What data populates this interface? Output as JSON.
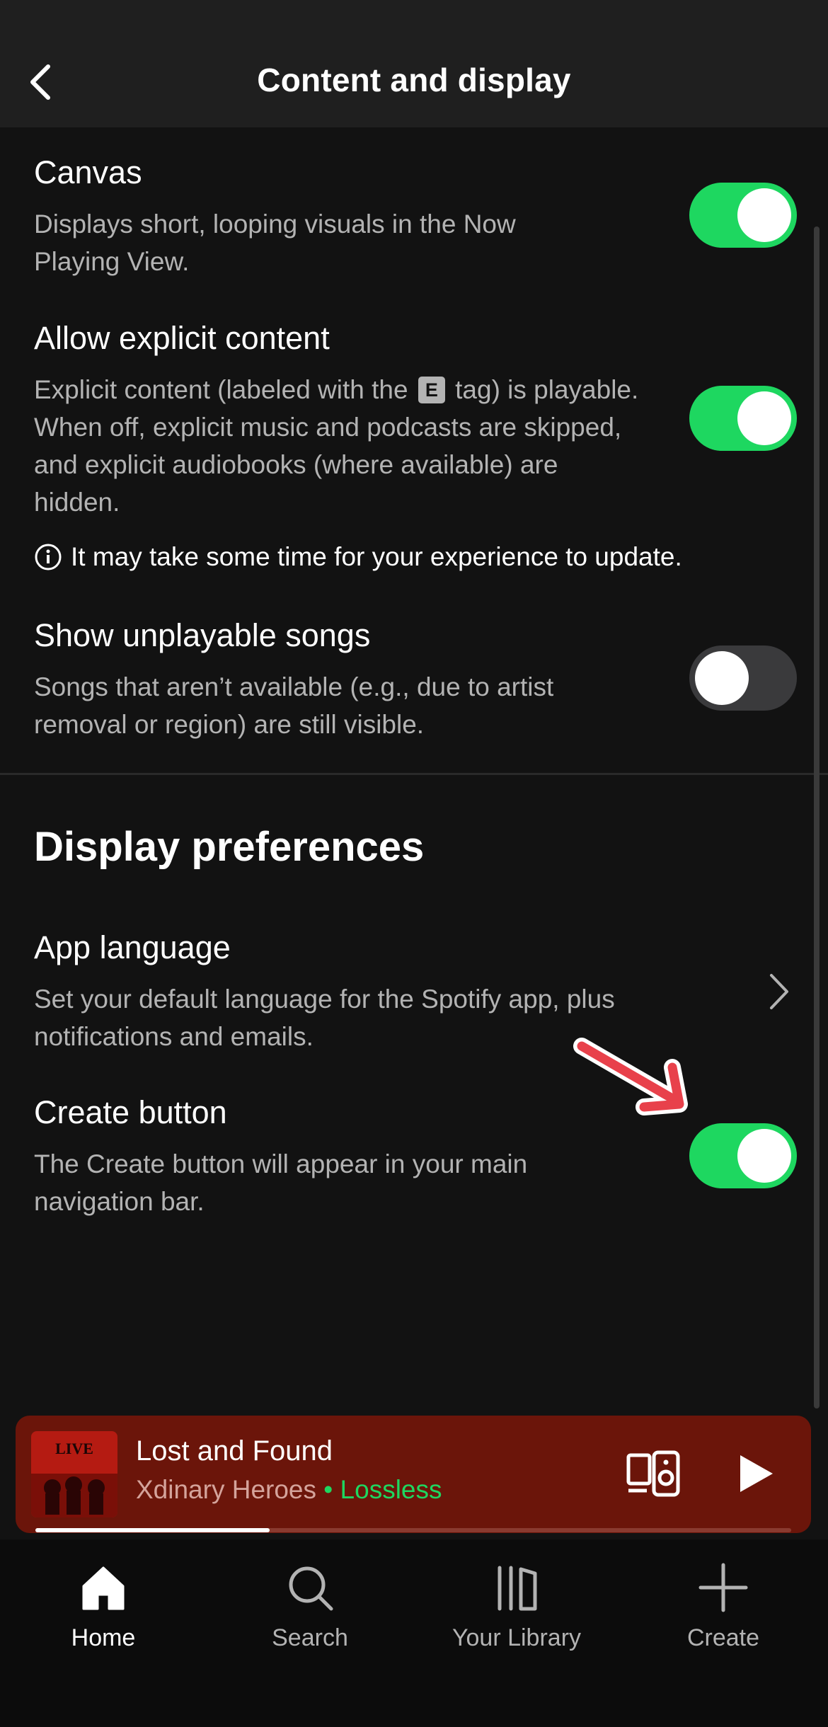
{
  "header": {
    "title": "Content and display"
  },
  "settings": [
    {
      "title": "Canvas",
      "description": "Displays short, looping visuals in the Now Playing View.",
      "toggle_on": true
    },
    {
      "title": "Allow explicit content",
      "description_before_tag": "Explicit content (labeled with the",
      "tag_label": "E",
      "description_after_tag": "tag) is playable. When off, explicit music and podcasts are skipped, and explicit audiobooks (where available) are hidden.",
      "toggle_on": true
    },
    {
      "title": "Show unplayable songs",
      "description": "Songs that aren’t available (e.g., due to artist removal or region) are still visible.",
      "toggle_on": false
    }
  ],
  "info_note": "It may take some time for your experience to update.",
  "display_preferences": {
    "heading": "Display preferences",
    "app_language": {
      "title": "App language",
      "description": "Set your default language for the Spotify app, plus notifications and emails."
    },
    "create_button": {
      "title": "Create button",
      "description": "The Create button will appear in your main navigation bar.",
      "toggle_on": true
    }
  },
  "now_playing": {
    "title": "Lost and Found",
    "artist": "Xdinary Heroes",
    "separator": "•",
    "quality": "Lossless",
    "progress": 0.31
  },
  "nav": [
    {
      "label": "Home",
      "icon": "home-icon",
      "active": true
    },
    {
      "label": "Search",
      "icon": "search-icon",
      "active": false
    },
    {
      "label": "Your Library",
      "icon": "library-icon",
      "active": false
    },
    {
      "label": "Create",
      "icon": "plus-icon",
      "active": false
    }
  ],
  "colors": {
    "accent": "#1ed760",
    "background": "#121212",
    "now_playing_bg": "#6b150a",
    "annotation_arrow": "#e8414b"
  }
}
